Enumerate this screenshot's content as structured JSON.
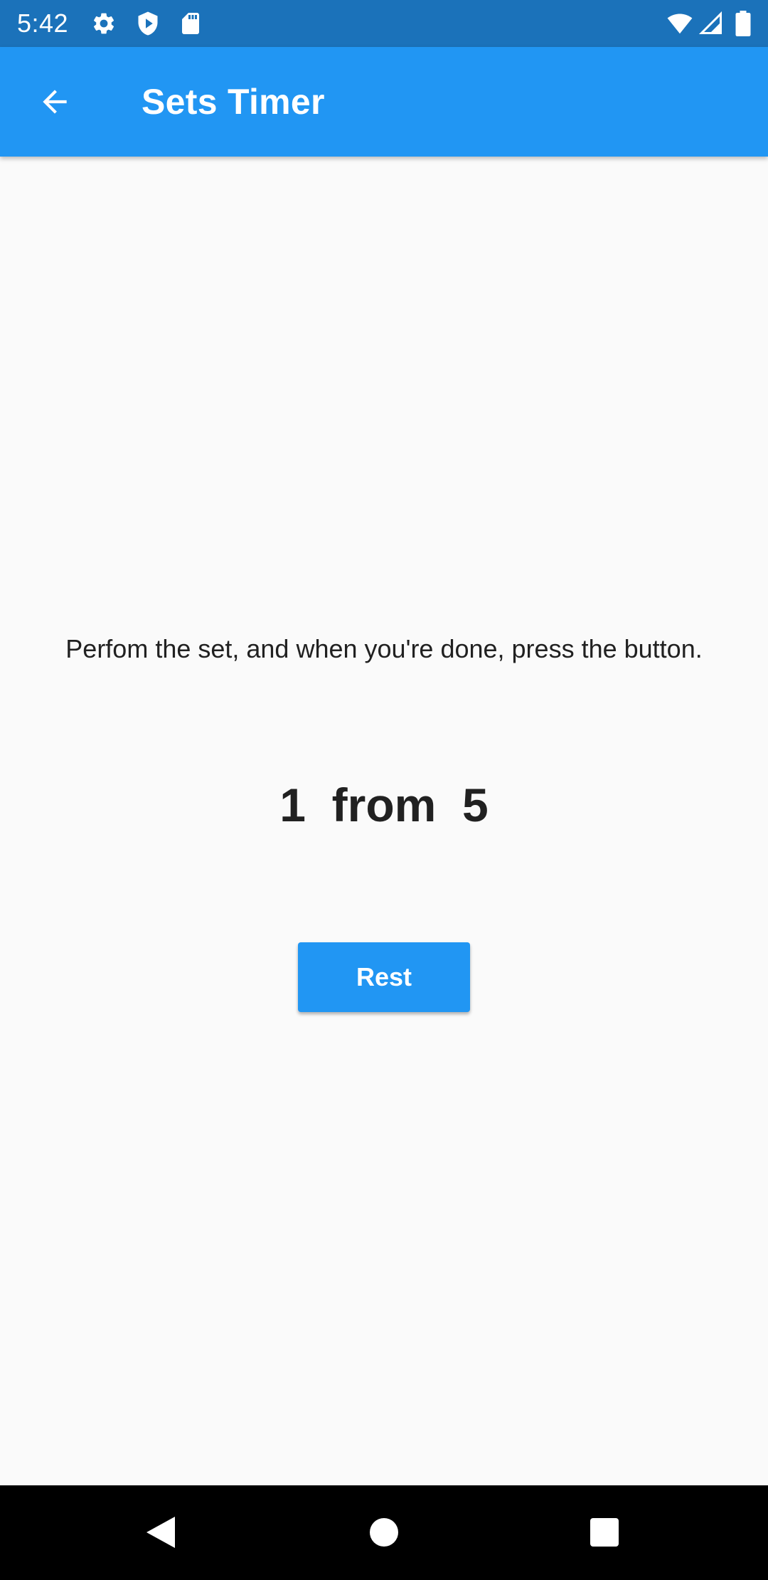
{
  "status_bar": {
    "time": "5:42",
    "left_icons": [
      "settings-icon",
      "shield-play-icon",
      "sd-card-icon"
    ],
    "right_icons": [
      "wifi-icon",
      "signal-icon",
      "battery-icon"
    ]
  },
  "app_bar": {
    "title": "Sets Timer",
    "back_icon": "arrow-back-icon"
  },
  "main": {
    "instruction": "Perfom the set, and when you're done, press the button.",
    "counter": {
      "current": "1",
      "separator": "from",
      "total": "5"
    },
    "rest_button_label": "Rest"
  },
  "nav_bar": {
    "buttons": [
      "back-triangle-icon",
      "home-circle-icon",
      "recents-square-icon"
    ]
  },
  "colors": {
    "status_bar": "#1b72ba",
    "app_bar": "#2196f3",
    "background": "#fafafa",
    "text": "#212121",
    "button": "#2196f3",
    "nav_bar": "#000000"
  }
}
